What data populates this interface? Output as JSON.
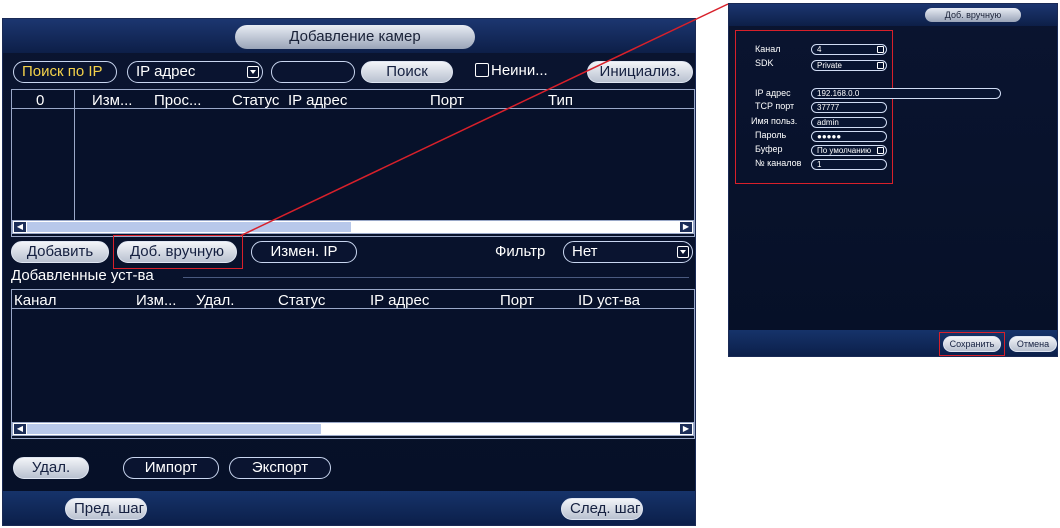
{
  "main": {
    "title": "Добавление камер",
    "search_by_ip": "Поиск по IP",
    "search_type_value": "IP адрес",
    "search_field_value": "",
    "search_button": "Поиск",
    "uninit_label": "Неини...",
    "initialize_button": "Инициализ.",
    "found_table": {
      "columns": [
        "0",
        "Изм...",
        "Прос...",
        "Статус",
        "IP адрес",
        "Порт",
        "Тип"
      ]
    },
    "add_button": "Добавить",
    "manual_add_button": "Доб. вручную",
    "change_ip_button": "Измен. IP",
    "filter_label": "Фильтр",
    "filter_value": "Нет",
    "added_devices_label": "Добавленные уст-ва",
    "added_table": {
      "columns": [
        "Канал",
        "Изм...",
        "Удал.",
        "Статус",
        "IP адрес",
        "Порт",
        "ID уст-ва"
      ]
    },
    "delete_button": "Удал.",
    "import_button": "Импорт",
    "export_button": "Экспорт",
    "prev_button": "Пред. шаг",
    "next_button": "След. шаг"
  },
  "inset": {
    "title": "Доб. вручную",
    "channel_label": "Канал",
    "channel_value": "4",
    "sdk_label": "SDK",
    "sdk_value": "Private",
    "ip_label": "IP адрес",
    "ip_value": "192.168.0.0",
    "tcp_label": "TCP порт",
    "tcp_value": "37777",
    "user_label": "Имя польз.",
    "user_value": "admin",
    "password_label": "Пароль",
    "password_value": "●●●●●",
    "buffer_label": "Буфер",
    "buffer_value": "По умолчанию",
    "channels_label": "№ каналов",
    "channels_value": "1",
    "save_button": "Сохранить",
    "cancel_button": "Отмена"
  },
  "colors": {
    "panel_bg": "#0a1430",
    "highlight": "#d8202a",
    "accent_text": "#f4d24a"
  }
}
